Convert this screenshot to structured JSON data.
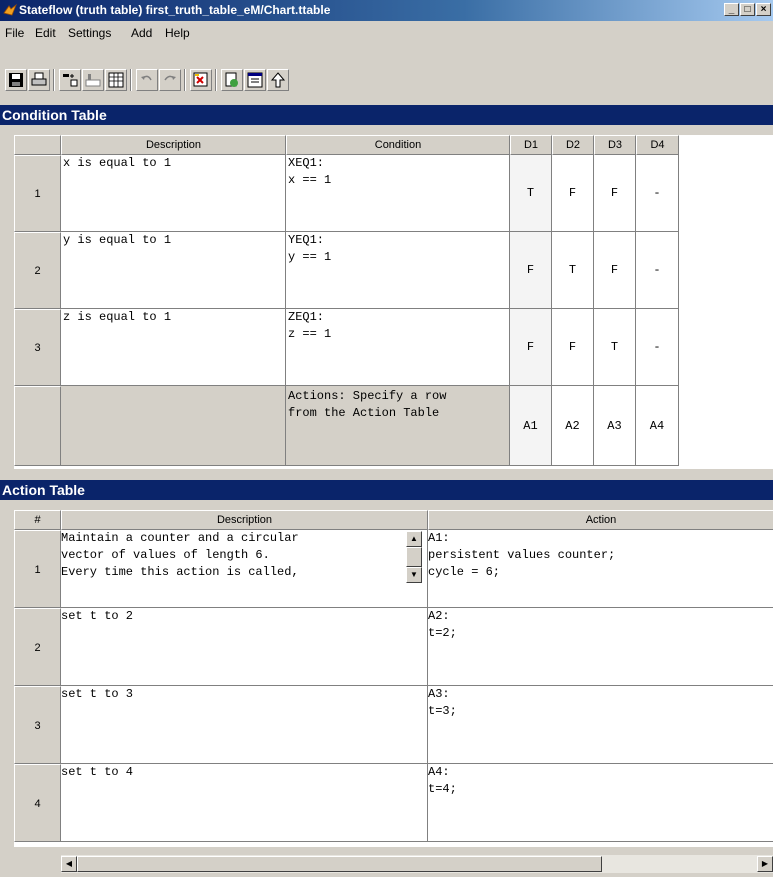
{
  "window": {
    "title": "Stateflow (truth table) first_truth_table_eM/Chart.ttable",
    "minimize": "_",
    "maximize": "□",
    "close": "×"
  },
  "menu": [
    "File",
    "Edit",
    "Settings",
    "Add",
    "Help"
  ],
  "toolbar": {
    "buttons": [
      "save-icon",
      "print-icon",
      "add-row-icon",
      "add-column-icon",
      "table-icon",
      "undo-icon",
      "redo-icon",
      "diagnose-icon",
      "edit-data-icon",
      "properties-icon",
      "go-to-parent-icon"
    ]
  },
  "condition_table": {
    "title": "Condition Table",
    "headers": {
      "description": "Description",
      "condition": "Condition",
      "decisions": [
        "D1",
        "D2",
        "D3",
        "D4"
      ]
    },
    "rows": [
      {
        "num": "1",
        "description": "x is equal to 1",
        "condition_label": "XEQ1:",
        "condition_expr": "x == 1",
        "decisions": [
          "T",
          "F",
          "F",
          "-"
        ]
      },
      {
        "num": "2",
        "description": "y is equal to 1",
        "condition_label": "YEQ1:",
        "condition_expr": "y == 1",
        "decisions": [
          "F",
          "T",
          "F",
          "-"
        ]
      },
      {
        "num": "3",
        "description": "z is equal to 1",
        "condition_label": "ZEQ1:",
        "condition_expr": "z == 1",
        "decisions": [
          "F",
          "F",
          "T",
          "-"
        ]
      }
    ],
    "actions_row": {
      "line1": "Actions: Specify a row",
      "line2": "from the Action Table",
      "values": [
        "A1",
        "A2",
        "A3",
        "A4"
      ]
    }
  },
  "action_table": {
    "title": "Action Table",
    "headers": {
      "num": "#",
      "description": "Description",
      "action": "Action"
    },
    "rows": [
      {
        "num": "1",
        "desc_lines": [
          "Maintain a counter and a circular",
          "vector of values of length 6.",
          "Every time this action is called,"
        ],
        "action_lines": [
          "A1:",
          "persistent values counter;",
          "cycle = 6;"
        ]
      },
      {
        "num": "2",
        "desc_lines": [
          "set t to 2"
        ],
        "action_lines": [
          "A2:",
          "t=2;"
        ]
      },
      {
        "num": "3",
        "desc_lines": [
          "set t to 3"
        ],
        "action_lines": [
          "A3:",
          "t=3;"
        ]
      },
      {
        "num": "4",
        "desc_lines": [
          "set t to 4"
        ],
        "action_lines": [
          "A4:",
          "t=4;"
        ]
      }
    ]
  }
}
